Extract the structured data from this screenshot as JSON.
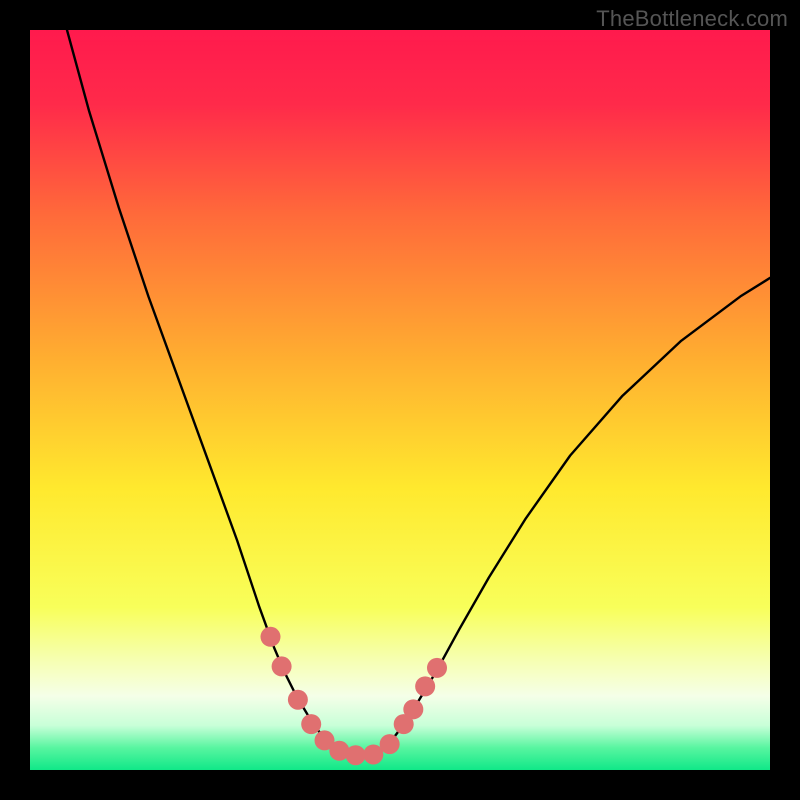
{
  "watermark": "TheBottleneck.com",
  "chart_data": {
    "type": "line",
    "title": "",
    "xlabel": "",
    "ylabel": "",
    "xlim": [
      0,
      100
    ],
    "ylim": [
      0,
      100
    ],
    "background_gradient": {
      "stops": [
        {
          "offset": 0.0,
          "color": "#ff1a4d"
        },
        {
          "offset": 0.1,
          "color": "#ff2a4a"
        },
        {
          "offset": 0.25,
          "color": "#ff6a3a"
        },
        {
          "offset": 0.45,
          "color": "#ffb030"
        },
        {
          "offset": 0.62,
          "color": "#ffe92e"
        },
        {
          "offset": 0.78,
          "color": "#f8ff5a"
        },
        {
          "offset": 0.85,
          "color": "#f6ffb0"
        },
        {
          "offset": 0.9,
          "color": "#f5ffe8"
        },
        {
          "offset": 0.94,
          "color": "#c8ffd8"
        },
        {
          "offset": 0.97,
          "color": "#58f5a0"
        },
        {
          "offset": 1.0,
          "color": "#10e888"
        }
      ]
    },
    "series": [
      {
        "name": "curve",
        "color": "#000000",
        "width": 2.4,
        "x": [
          5,
          8,
          12,
          16,
          20,
          24,
          28,
          31,
          33,
          34.5,
          36,
          37.5,
          38.8,
          40.5,
          42.5,
          45,
          47,
          48.5,
          50,
          52,
          55,
          58,
          62,
          67,
          73,
          80,
          88,
          96,
          100
        ],
        "y": [
          100,
          89,
          76,
          64,
          53,
          42,
          31,
          22,
          16.5,
          13,
          10,
          7.5,
          5.5,
          3.5,
          2.3,
          1.9,
          2.3,
          3.5,
          5.5,
          8.5,
          13.5,
          19,
          26,
          34,
          42.5,
          50.5,
          58,
          64,
          66.5
        ]
      }
    ],
    "highlight_dots": {
      "color": "#e07070",
      "radius": 10,
      "points": [
        {
          "x": 32.5,
          "y": 18.0
        },
        {
          "x": 34.0,
          "y": 14.0
        },
        {
          "x": 36.2,
          "y": 9.5
        },
        {
          "x": 38.0,
          "y": 6.2
        },
        {
          "x": 39.8,
          "y": 4.0
        },
        {
          "x": 41.8,
          "y": 2.6
        },
        {
          "x": 44.0,
          "y": 2.0
        },
        {
          "x": 46.4,
          "y": 2.1
        },
        {
          "x": 48.6,
          "y": 3.5
        },
        {
          "x": 50.5,
          "y": 6.2
        },
        {
          "x": 51.8,
          "y": 8.2
        },
        {
          "x": 53.4,
          "y": 11.3
        },
        {
          "x": 55.0,
          "y": 13.8
        }
      ]
    }
  }
}
